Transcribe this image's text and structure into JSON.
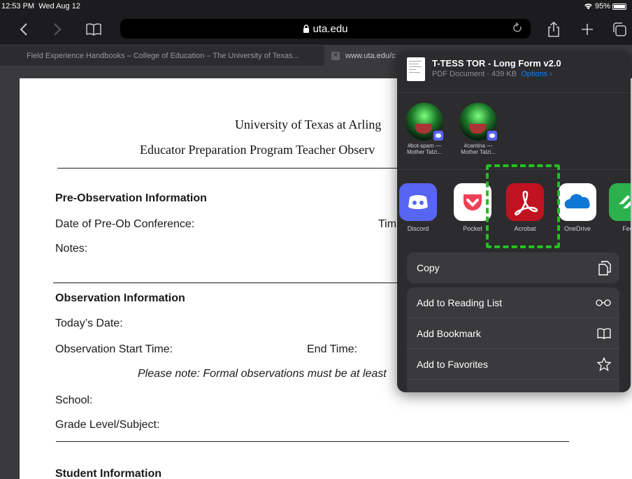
{
  "status": {
    "time": "12:53 PM",
    "date": "Wed Aug 12",
    "battery": "95%"
  },
  "toolbar": {
    "url": "uta.edu"
  },
  "tabs": [
    {
      "label": "Field Experience Handbooks – College of Education – The University of Texas..."
    },
    {
      "label": "www.uta.edu/c"
    }
  ],
  "document": {
    "title1": "University of Texas at Arling",
    "title2": "Educator Preparation Program Teacher Observ",
    "pre_heading": "Pre-Observation Information",
    "pre_date": "Date of Pre-Ob Conference:",
    "pre_time": "Tim",
    "notes": "Notes:",
    "obs_heading": "Observation Information",
    "today": "Today’s Date:",
    "start": "Observation Start Time:",
    "end": "End Time:",
    "note": "Please note: Formal observations must be at least",
    "school": "School:",
    "grade": "Grade Level/Subject:",
    "student_heading": "Student Information"
  },
  "share": {
    "doc_title": "T-TESS TOR - Long Form v2.0",
    "doc_meta": "PDF Document · 439 KB",
    "options": "Options ›",
    "contacts": [
      {
        "line1": "#bot-spam —",
        "line2": "Mother Talzi..."
      },
      {
        "line1": "#cantina —",
        "line2": "Mother Talzi..."
      }
    ],
    "apps": [
      {
        "label": "Discord"
      },
      {
        "label": "Pocket"
      },
      {
        "label": "Acrobat"
      },
      {
        "label": "OneDrive"
      },
      {
        "label": "Fee"
      }
    ],
    "copy": "Copy",
    "actions": [
      {
        "label": "Add to Reading List",
        "icon": "glasses-icon"
      },
      {
        "label": "Add Bookmark",
        "icon": "book-icon"
      },
      {
        "label": "Add to Favorites",
        "icon": "star-icon"
      }
    ]
  },
  "colors": {
    "highlight": "#22c21e",
    "link": "#0a84ff",
    "acrobat": "#c1121f",
    "discord": "#5865f2"
  }
}
